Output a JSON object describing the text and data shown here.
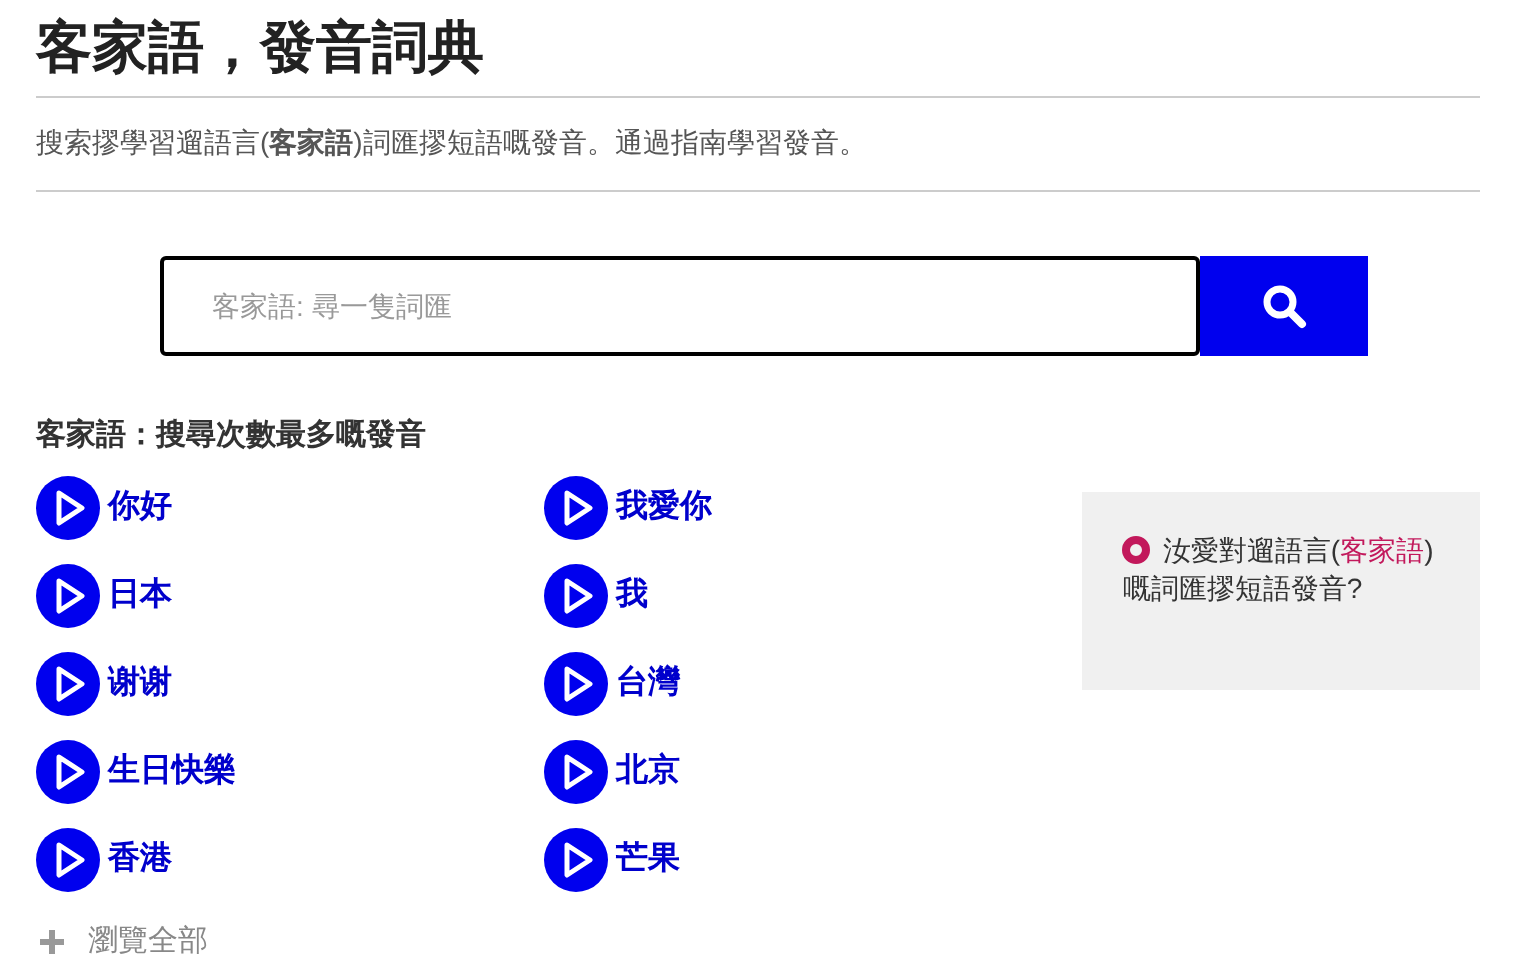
{
  "title": "客家語，發音詞典",
  "description": "搜索摎學習遛語言(**客家語**)詞匯摎短語嘅發音。通過指南學習發音。",
  "search": {
    "placeholder": "客家語: 尋一隻詞匯"
  },
  "popular": {
    "heading": "客家語：搜尋次數最多嘅發音",
    "words": [
      {
        "text": "你好"
      },
      {
        "text": "我愛你"
      },
      {
        "text": "日本"
      },
      {
        "text": "我"
      },
      {
        "text": "谢谢"
      },
      {
        "text": "台灣"
      },
      {
        "text": "生日快樂"
      },
      {
        "text": "北京"
      },
      {
        "text": "香港"
      },
      {
        "text": "芒果"
      }
    ],
    "browse_all": "瀏覽全部"
  },
  "side_box": {
    "before": "汝愛對遛語言(",
    "link": "客家語",
    "after": ")嘅詞匯摎短語發音?"
  }
}
